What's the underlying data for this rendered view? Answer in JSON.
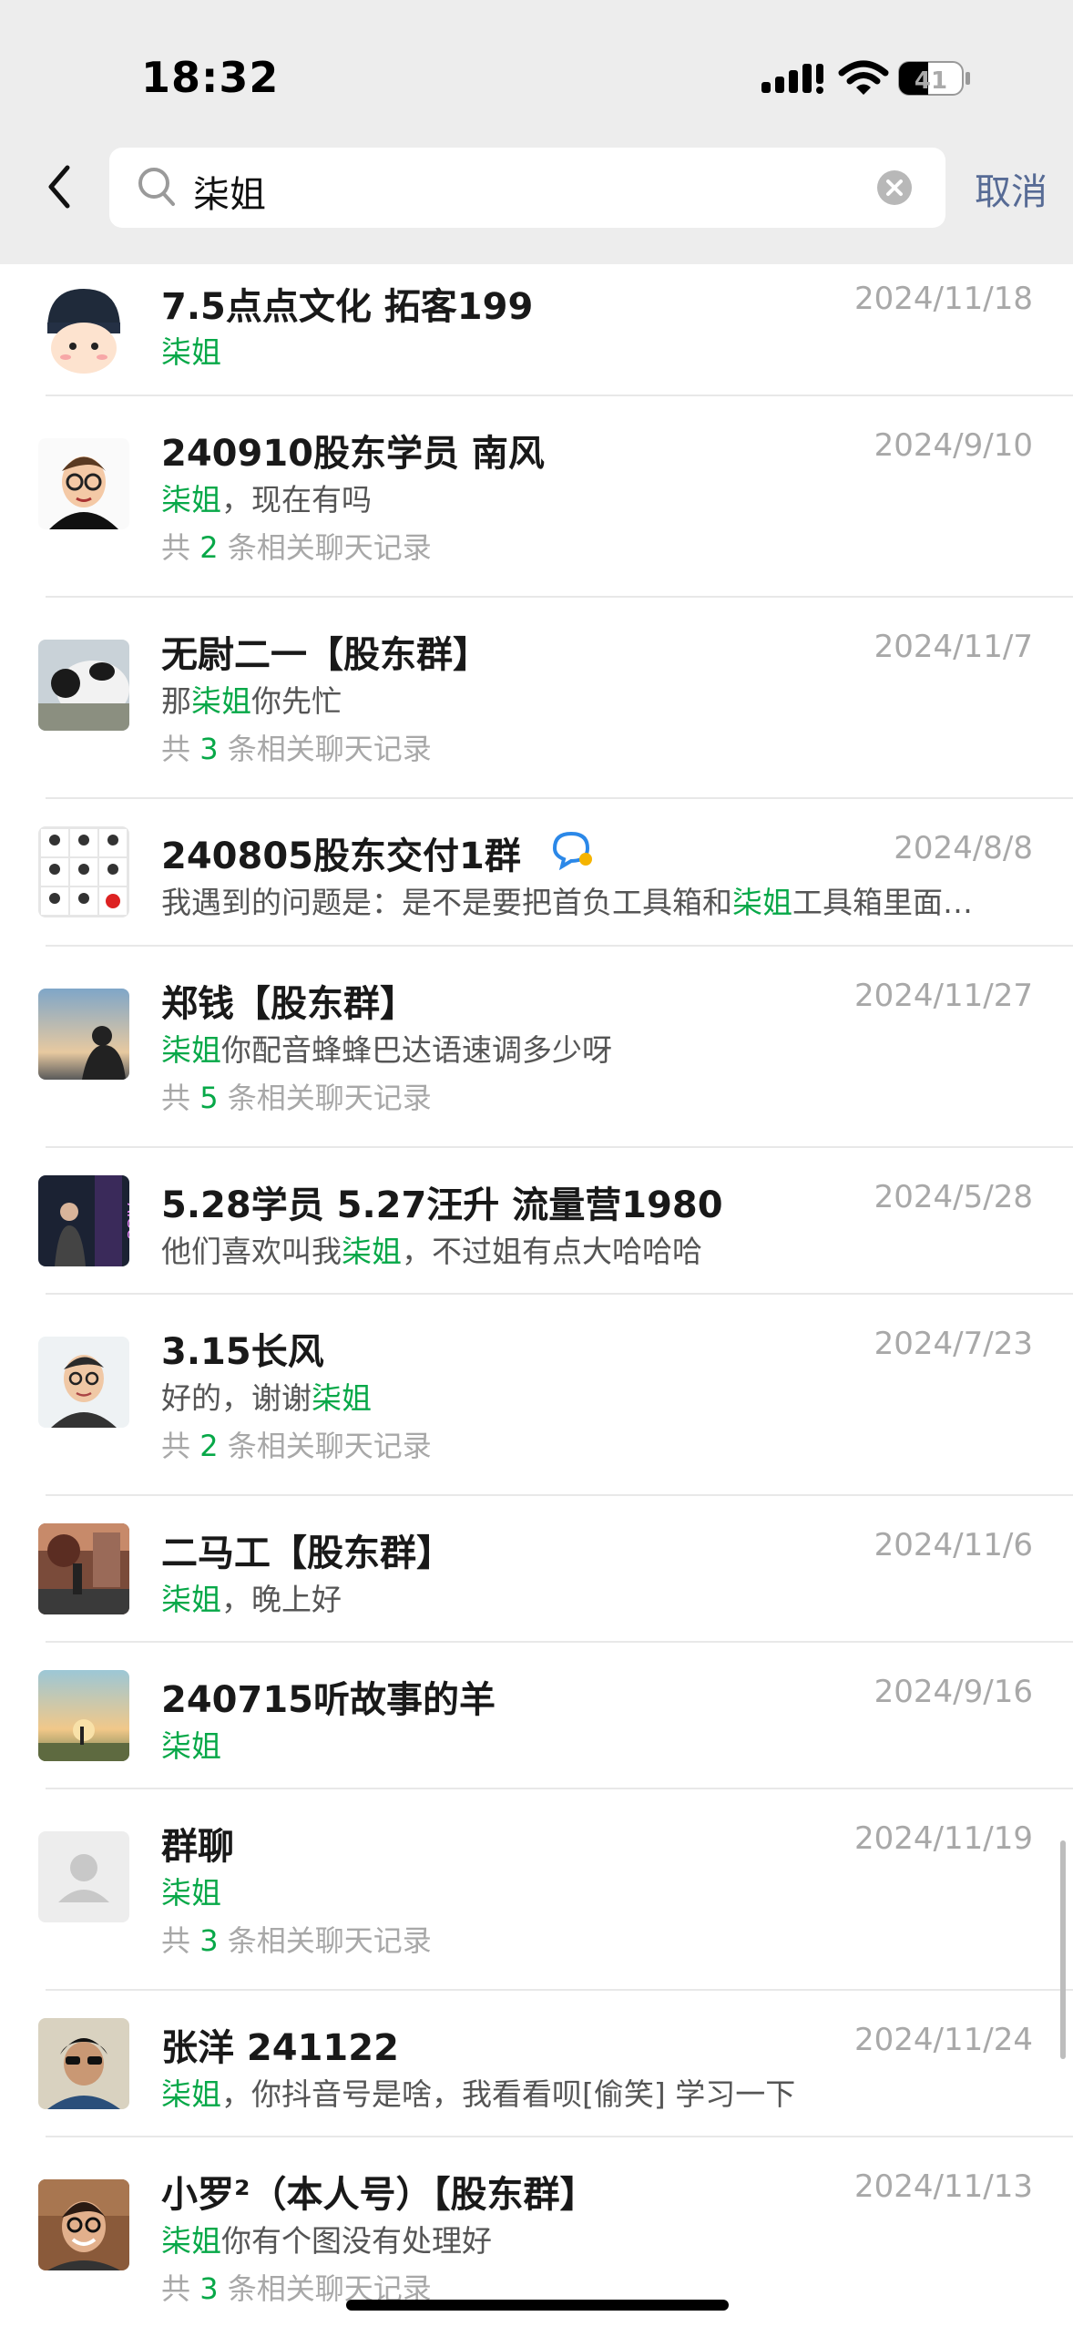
{
  "status_bar": {
    "time": "18:32",
    "battery": "41"
  },
  "search": {
    "query": "柒姐",
    "cancel_label": "取消"
  },
  "results": [
    {
      "title": "7.5点点文化 拓客199",
      "date": "2024/11/18",
      "line": [
        {
          "t": "柒姐",
          "hl": true
        }
      ],
      "count_pre": "",
      "count_num": "",
      "count_post": "",
      "avatar_icon": "beanie-cartoon-avatar"
    },
    {
      "title": "240910股东学员 南风",
      "date": "2024/9/10",
      "line": [
        {
          "t": "柒姐",
          "hl": true
        },
        {
          "t": "，现在有吗",
          "hl": false
        }
      ],
      "count_pre": "共 ",
      "count_num": "2",
      "count_post": " 条相关聊天记录",
      "avatar_icon": "glasses-cartoon-avatar"
    },
    {
      "title": "无尉二一【股东群】",
      "date": "2024/11/7",
      "line": [
        {
          "t": "那",
          "hl": false
        },
        {
          "t": "柒姐",
          "hl": true
        },
        {
          "t": "你先忙",
          "hl": false
        }
      ],
      "count_pre": "共 ",
      "count_num": "3",
      "count_post": " 条相关聊天记录",
      "avatar_icon": "panda-avatar"
    },
    {
      "title": "240805股东交付1群",
      "date": "2024/8/8",
      "line": [
        {
          "t": "我遇到的问题是：是不是要把首负工具箱和",
          "hl": false
        },
        {
          "t": "柒姐",
          "hl": true
        },
        {
          "t": "工具箱里面…",
          "hl": false
        }
      ],
      "count_pre": "",
      "count_num": "",
      "count_post": "",
      "avatar_icon": "group-grid-avatar",
      "badge": true
    },
    {
      "title": "郑钱【股东群】",
      "date": "2024/11/27",
      "line": [
        {
          "t": "柒姐",
          "hl": true
        },
        {
          "t": "你配音蜂蜂巴达语速调多少呀",
          "hl": false
        }
      ],
      "count_pre": "共 ",
      "count_num": "5",
      "count_post": " 条相关聊天记录",
      "avatar_icon": "sunset-silhouette-avatar"
    },
    {
      "title": "5.28学员 5.27汪升 流量营1980",
      "date": "2024/5/28",
      "line": [
        {
          "t": "他们喜欢叫我",
          "hl": false
        },
        {
          "t": "柒姐",
          "hl": true
        },
        {
          "t": "，不过姐有点大哈哈哈",
          "hl": false
        }
      ],
      "count_pre": "",
      "count_num": "",
      "count_post": "",
      "avatar_icon": "aigc-neon-avatar"
    },
    {
      "title": "3.15长风",
      "date": "2024/7/23",
      "line": [
        {
          "t": "好的，谢谢",
          "hl": false
        },
        {
          "t": "柒姐",
          "hl": true
        }
      ],
      "count_pre": "共 ",
      "count_num": "2",
      "count_post": " 条相关聊天记录",
      "avatar_icon": "cartoon-man-avatar"
    },
    {
      "title": "二马工【股东群】",
      "date": "2024/11/6",
      "line": [
        {
          "t": "柒姐",
          "hl": true
        },
        {
          "t": "，晚上好",
          "hl": false
        }
      ],
      "count_pre": "",
      "count_num": "",
      "count_post": "",
      "avatar_icon": "street-photo-avatar"
    },
    {
      "title": "240715听故事的羊",
      "date": "2024/9/16",
      "line": [
        {
          "t": "柒姐",
          "hl": true
        }
      ],
      "count_pre": "",
      "count_num": "",
      "count_post": "",
      "avatar_icon": "sunset-kite-avatar"
    },
    {
      "title": "群聊",
      "date": "2024/11/19",
      "line": [
        {
          "t": "柒姐",
          "hl": true
        }
      ],
      "count_pre": "共 ",
      "count_num": "3",
      "count_post": " 条相关聊天记录",
      "avatar_icon": "default-person-avatar"
    },
    {
      "title": "张洋 241122",
      "date": "2024/11/24",
      "line": [
        {
          "t": "柒姐",
          "hl": true
        },
        {
          "t": "，你抖音号是啥，我看看呗[偷笑] 学习一下",
          "hl": false
        }
      ],
      "count_pre": "",
      "count_num": "",
      "count_post": "",
      "avatar_icon": "sunglasses-man-avatar"
    },
    {
      "title": "小罗²（本人号）【股东群】",
      "date": "2024/11/13",
      "line": [
        {
          "t": "柒姐",
          "hl": true
        },
        {
          "t": "你有个图没有处理好",
          "hl": false
        }
      ],
      "count_pre": "共 ",
      "count_num": "3",
      "count_post": " 条相关聊天记录",
      "avatar_icon": "smiling-man-avatar"
    }
  ]
}
